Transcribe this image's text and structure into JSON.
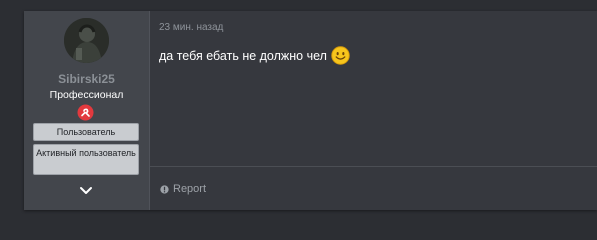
{
  "post": {
    "author": {
      "username": "Sibirski25",
      "title": "Профессионал",
      "banners": [
        "Пользователь",
        "Активный пользователь"
      ]
    },
    "time": "23 мин. назад",
    "message": "да тебя ебать не должно чел",
    "emoji": "smiley-icon",
    "actions": {
      "report_label": "Report"
    }
  },
  "colors": {
    "page_bg": "#2c2e33",
    "post_bg": "#36383e",
    "user_col_bg": "#43464c",
    "username": "#8b9096",
    "badge_red": "#e2393e"
  }
}
